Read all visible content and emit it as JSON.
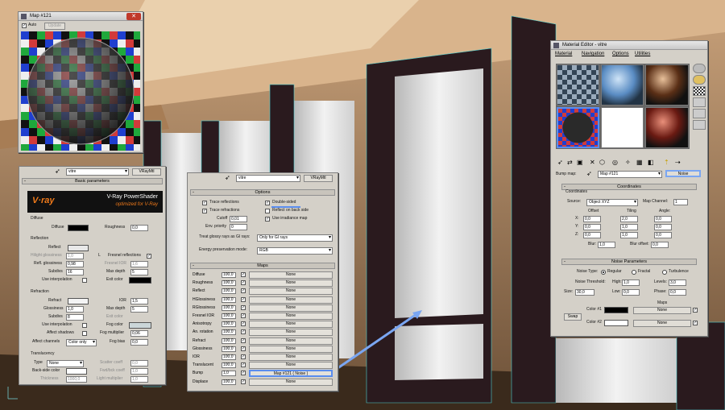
{
  "map_window": {
    "title": "Map #121",
    "auto_label": "Auto",
    "update_label": "Update"
  },
  "vray_panel": {
    "material_name": "vitre",
    "material_type": "VRayMtl",
    "rollout_basic": "Basic parameters",
    "logo_text": "V·ray",
    "banner_title": "V-Ray PowerShader",
    "banner_subtitle": "optimized for V-Ray",
    "diffuse": {
      "group": "Diffuse",
      "label": "Diffuse",
      "roughness_label": "Roughness",
      "roughness_value": "0,0"
    },
    "reflection": {
      "group": "Reflection",
      "reflect_label": "Reflect",
      "hilight_label": "Hilight glossiness",
      "hilight_value": "1,0",
      "refl_gloss_label": "Refl. glossiness",
      "refl_gloss_value": "0,98",
      "subdivs_label": "Subdivs",
      "subdivs_value": "16",
      "use_interp_label": "Use interpolation",
      "fresnel_label": "Fresnel reflections",
      "fresnel_ior_label": "Fresnel IOR",
      "fresnel_ior_value": "1,6",
      "max_depth_label": "Max depth",
      "max_depth_value": "5",
      "exit_color_label": "Exit color",
      "l_label": "L"
    },
    "refraction": {
      "group": "Refraction",
      "refract_label": "Refract",
      "ior_label": "IOR",
      "ior_value": "1,5",
      "glossiness_label": "Glossiness",
      "glossiness_value": "1,0",
      "max_depth_label": "Max depth",
      "max_depth_value": "5",
      "subdivs_label": "Subdivs",
      "subdivs_value": "8",
      "exit_color_label": "Exit color",
      "use_interp_label": "Use interpolation",
      "fog_color_label": "Fog color",
      "affect_shadows_label": "Affect shadows",
      "fog_mult_label": "Fog multiplier",
      "fog_mult_value": "0,06",
      "affect_channels_label": "Affect channels",
      "affect_channels_value": "Color only",
      "fog_bias_label": "Fog bias",
      "fog_bias_value": "0,0"
    },
    "translucency": {
      "group": "Translucency",
      "type_label": "Type",
      "type_value": "None",
      "backside_label": "Back-side color",
      "thickness_label": "Thickness",
      "thickness_value": "1000,0",
      "scatter_label": "Scatter coeff",
      "scatter_value": "0,0",
      "fwdbck_label": "Fwd/bck coeff",
      "fwdbck_value": "1,0",
      "light_mult_label": "Light multiplier",
      "light_mult_value": "1,0"
    }
  },
  "options_panel": {
    "material_name": "vitre",
    "material_type": "VRayMtl",
    "rollout_options": "Options",
    "trace_reflections": "Trace reflections",
    "trace_refractions": "Trace refractions",
    "cutoff_label": "Cutoff",
    "cutoff_value": "0,01",
    "env_priority_label": "Env. priority",
    "env_priority_value": "0",
    "double_sided": "Double-sided",
    "reflect_back": "Reflect on back side",
    "irradiance": "Use irradiance map",
    "glossy_label": "Treat glossy rays as GI rays:",
    "glossy_value": "Only for GI rays",
    "energy_label": "Energy preservation mode:",
    "energy_value": "RGB",
    "rollout_maps": "Maps",
    "maps": [
      {
        "label": "Diffuse",
        "amount": "100,0",
        "map": "None"
      },
      {
        "label": "Roughness",
        "amount": "100,0",
        "map": "None"
      },
      {
        "label": "Reflect",
        "amount": "100,0",
        "map": "None"
      },
      {
        "label": "HGlossiness",
        "amount": "100,0",
        "map": "None"
      },
      {
        "label": "RGlossiness",
        "amount": "100,0",
        "map": "None"
      },
      {
        "label": "Fresnel IOR",
        "amount": "100,0",
        "map": "None"
      },
      {
        "label": "Anisotropy",
        "amount": "100,0",
        "map": "None"
      },
      {
        "label": "An. rotation",
        "amount": "100,0",
        "map": "None"
      },
      {
        "label": "Refract",
        "amount": "100,0",
        "map": "None"
      },
      {
        "label": "Glossiness",
        "amount": "100,0",
        "map": "None"
      },
      {
        "label": "IOR",
        "amount": "100,0",
        "map": "None"
      },
      {
        "label": "Translucent",
        "amount": "100,0",
        "map": "None"
      },
      {
        "label": "Bump",
        "amount": "1,0",
        "map": "Map #121  ( Noise )"
      },
      {
        "label": "Displace",
        "amount": "100,0",
        "map": "None"
      }
    ]
  },
  "material_editor": {
    "title": "Material Editor - vitre",
    "menu": [
      "Material",
      "Navigation",
      "Options",
      "Utilities"
    ],
    "bump_label": "Bump map:",
    "map_name": "Map #121",
    "map_type": "Noise",
    "coords": {
      "rollout": "Coordinates",
      "group": "Coordinates",
      "source_label": "Source:",
      "source_value": "Object XYZ",
      "map_channel_label": "Map Channel:",
      "map_channel_value": "1",
      "offset_label": "Offset",
      "tiling_label": "Tiling",
      "angle_label": "Angle:",
      "rows": [
        {
          "axis": "X:",
          "offset": "0,0",
          "tiling": "2,0",
          "angle": "0,0"
        },
        {
          "axis": "Y:",
          "offset": "0,0",
          "tiling": "1,0",
          "angle": "0,0"
        },
        {
          "axis": "Z:",
          "offset": "0,0",
          "tiling": "1,0",
          "angle": "0,0"
        }
      ],
      "blur_label": "Blur:",
      "blur_value": "1,0",
      "blur_offset_label": "Blur offset:",
      "blur_offset_value": "0,0"
    },
    "noise": {
      "rollout": "Noise Parameters",
      "type_label": "Noise Type:",
      "regular": "Regular",
      "fractal": "Fractal",
      "turbulence": "Turbulence",
      "threshold_label": "Noise Threshold:",
      "high_label": "High:",
      "high_value": "1,0",
      "levels_label": "Levels:",
      "levels_value": "3,0",
      "size_label": "Size:",
      "size_value": "30,0",
      "low_label": "Low:",
      "low_value": "0,0",
      "phase_label": "Phase:",
      "phase_value": "0,0",
      "maps_label": "Maps",
      "swap_label": "Swap",
      "color1_label": "Color #1",
      "color2_label": "Color #2",
      "none": "None"
    }
  },
  "colors": {
    "accent_blue": "#5a8dee",
    "panel": "#d4d0c8",
    "fog_color": "#cbd6d8"
  }
}
